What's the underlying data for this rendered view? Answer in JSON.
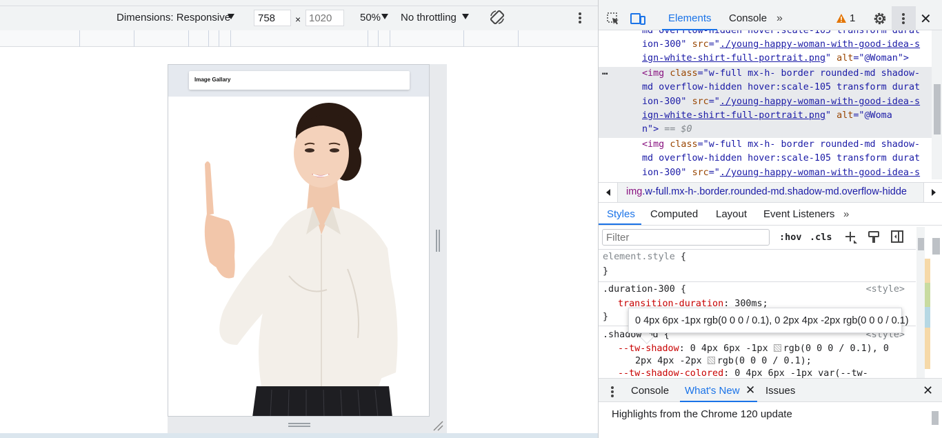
{
  "device_toolbar": {
    "dimensions_label": "Dimensions: Responsive",
    "width_value": "758",
    "times": "×",
    "height_placeholder": "1020",
    "zoom_label": "50%",
    "throttle_label": "No throttling"
  },
  "viewport": {
    "gallery_title": "Image Gallary",
    "image_alt": "@Woman"
  },
  "devtools": {
    "tabs": {
      "elements": "Elements",
      "console": "Console",
      "more": "»"
    },
    "warning_count": "1",
    "close": "✕",
    "code_lines": {
      "l1": "md overflow-hidden hover:scale-105 transform durat",
      "l2a": "ion-300\" ",
      "l2_src_name": "src",
      "l2_src_eq": "=\"",
      "l2_link": "./young-happy-woman-with-good-idea-s",
      "l3_link": "ign-white-shirt-full-portrait.png",
      "l3_tail_q": "\" ",
      "l3_alt_name": "alt",
      "l3_alt_val": "=\"@Woman\">",
      "l4_tag": "<img ",
      "l4_class_name": "class",
      "l4_class_val": "=\"w-full mx-h- border rounded-md shadow-",
      "l5": "md overflow-hidden hover:scale-105 transform durat",
      "l6a": "ion-300\" ",
      "l6_src_name": "src",
      "l6_src_eq": "=\"",
      "l6_link": "./young-happy-woman-with-good-idea-s",
      "l7_link": "ign-white-shirt-full-portrait.png",
      "l7_tail_q": "\" ",
      "l7_alt_name": "alt",
      "l7_alt_val": "=\"@Woma",
      "l8a": "n\">",
      "l8_eq": " == $0",
      "l9_tag": "<img ",
      "l9_class_name": "class",
      "l9_class_val": "=\"w-full mx-h- border rounded-md shadow-",
      "l10": "md overflow-hidden hover:scale-105 transform durat",
      "l11a": "ion-300\" ",
      "l11_src_name": "src",
      "l11_src_eq": "=\"",
      "l11_link": "./young-happy-woman-with-good-idea-s",
      "ellipsis": "…"
    },
    "breadcrumb": {
      "tag": "img",
      "classes": ".w-full.mx-h-.border.rounded-md.shadow-md.overflow-hidde"
    },
    "styles_tabs": {
      "styles": "Styles",
      "computed": "Computed",
      "layout": "Layout",
      "event_listeners": "Event Listeners",
      "more": "»"
    },
    "filter_placeholder": "Filter",
    "hov": ":hov",
    "cls": ".cls",
    "rules": {
      "element_style_selector": "element.style",
      "open_brace": " {",
      "close_brace": "}",
      "duration_selector": ".duration-300",
      "duration_source": "<style>",
      "duration_prop": "transition-duration",
      "duration_val": ": 300ms;",
      "shadow_selector": ".shadow-md",
      "shadow_source": "<style>",
      "tw_shadow_prop": "--tw-shadow",
      "tw_shadow_val1a": ": 0 4px 6px -1px ",
      "tw_shadow_val1b": "rgb(0 0 0 / 0.1), 0",
      "tw_shadow_val2a": "2px 4px -2px ",
      "tw_shadow_val2b": "rgb(0 0 0 / 0.1);",
      "tw_shadow_colored_prop": "--tw-shadow-colored",
      "tw_shadow_colored_val": ": 0 4px 6px -1px var(--tw-"
    },
    "tooltip": "0 4px 6px -1px rgb(0 0 0 / 0.1), 0 2px 4px -2px rgb(0 0 0 / 0.1)",
    "drawer": {
      "console": "Console",
      "whats_new": "What's New",
      "issues": "Issues",
      "highlights": "Highlights from the Chrome 120 update"
    }
  },
  "colors": {
    "accent": "#1a73e8",
    "tag": "#881280",
    "attr_name": "#994500",
    "attr_value": "#1a1aa6",
    "warning": "#e37400"
  }
}
